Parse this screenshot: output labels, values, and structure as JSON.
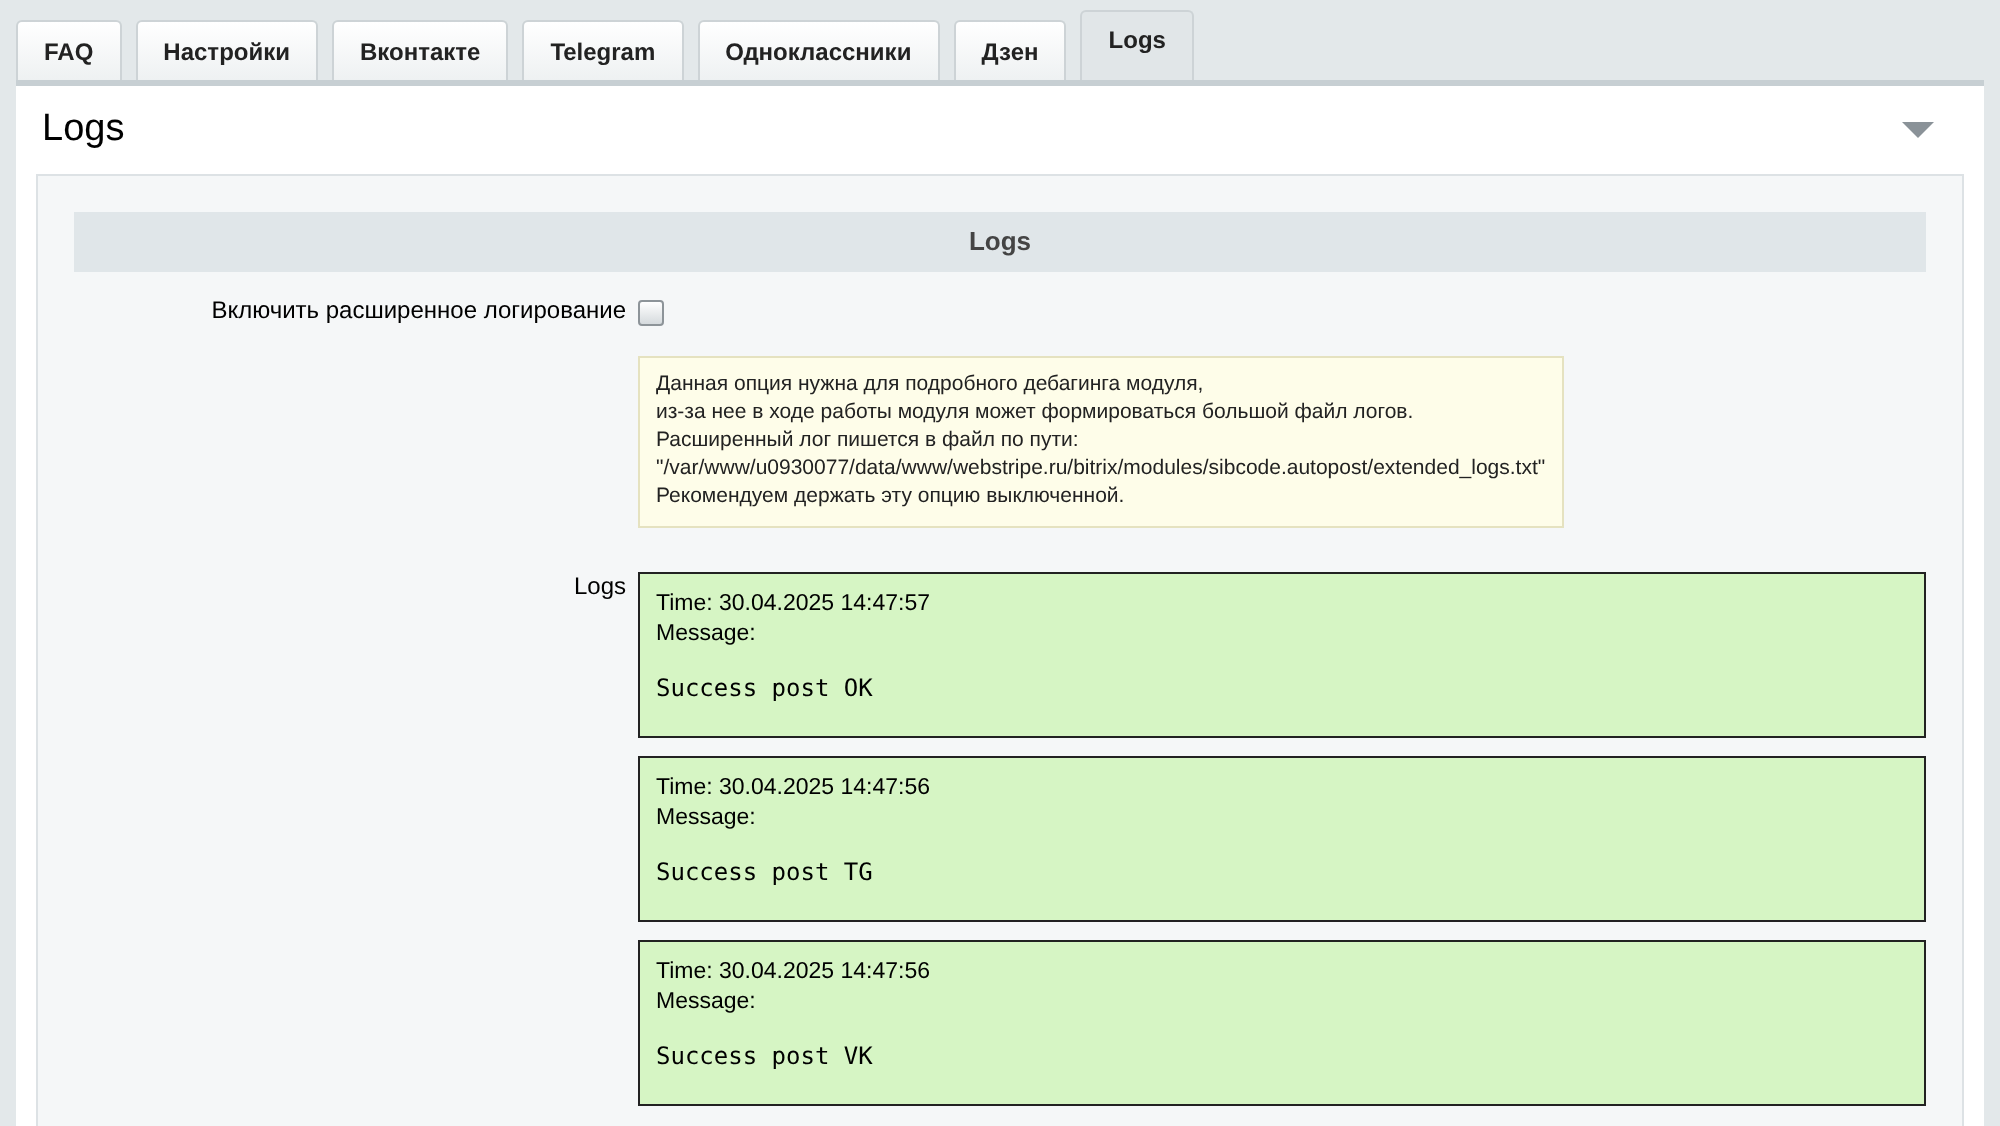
{
  "tabs": [
    {
      "label": "FAQ",
      "selected": false
    },
    {
      "label": "Настройки",
      "selected": false
    },
    {
      "label": "Вконтакте",
      "selected": false
    },
    {
      "label": "Telegram",
      "selected": false
    },
    {
      "label": "Одноклассники",
      "selected": false
    },
    {
      "label": "Дзен",
      "selected": false
    },
    {
      "label": "Logs",
      "selected": true
    }
  ],
  "panel": {
    "title": "Logs",
    "expanded": true,
    "section_title": "Logs",
    "extended_logging": {
      "label": "Включить расширенное логирование",
      "checked": false
    },
    "note": [
      "Данная опция нужна для подробного дебагинга модуля,",
      "из-за нее в ходе работы модуля может формироваться большой файл логов.",
      "Расширенный лог пишется в файл по пути:",
      "\"/var/www/u0930077/data/www/webstripe.ru/bitrix/modules/sibcode.autopost/extended_logs.txt\"",
      "Рекомендуем держать эту опцию выключенной."
    ],
    "logs_label": "Logs",
    "logs": [
      {
        "time": "Time: 30.04.2025 14:47:57",
        "message_label": "Message:",
        "message": "Success post OK"
      },
      {
        "time": "Time: 30.04.2025 14:47:56",
        "message_label": "Message:",
        "message": "Success post TG"
      },
      {
        "time": "Time: 30.04.2025 14:47:56",
        "message_label": "Message:",
        "message": "Success post VK"
      }
    ]
  }
}
